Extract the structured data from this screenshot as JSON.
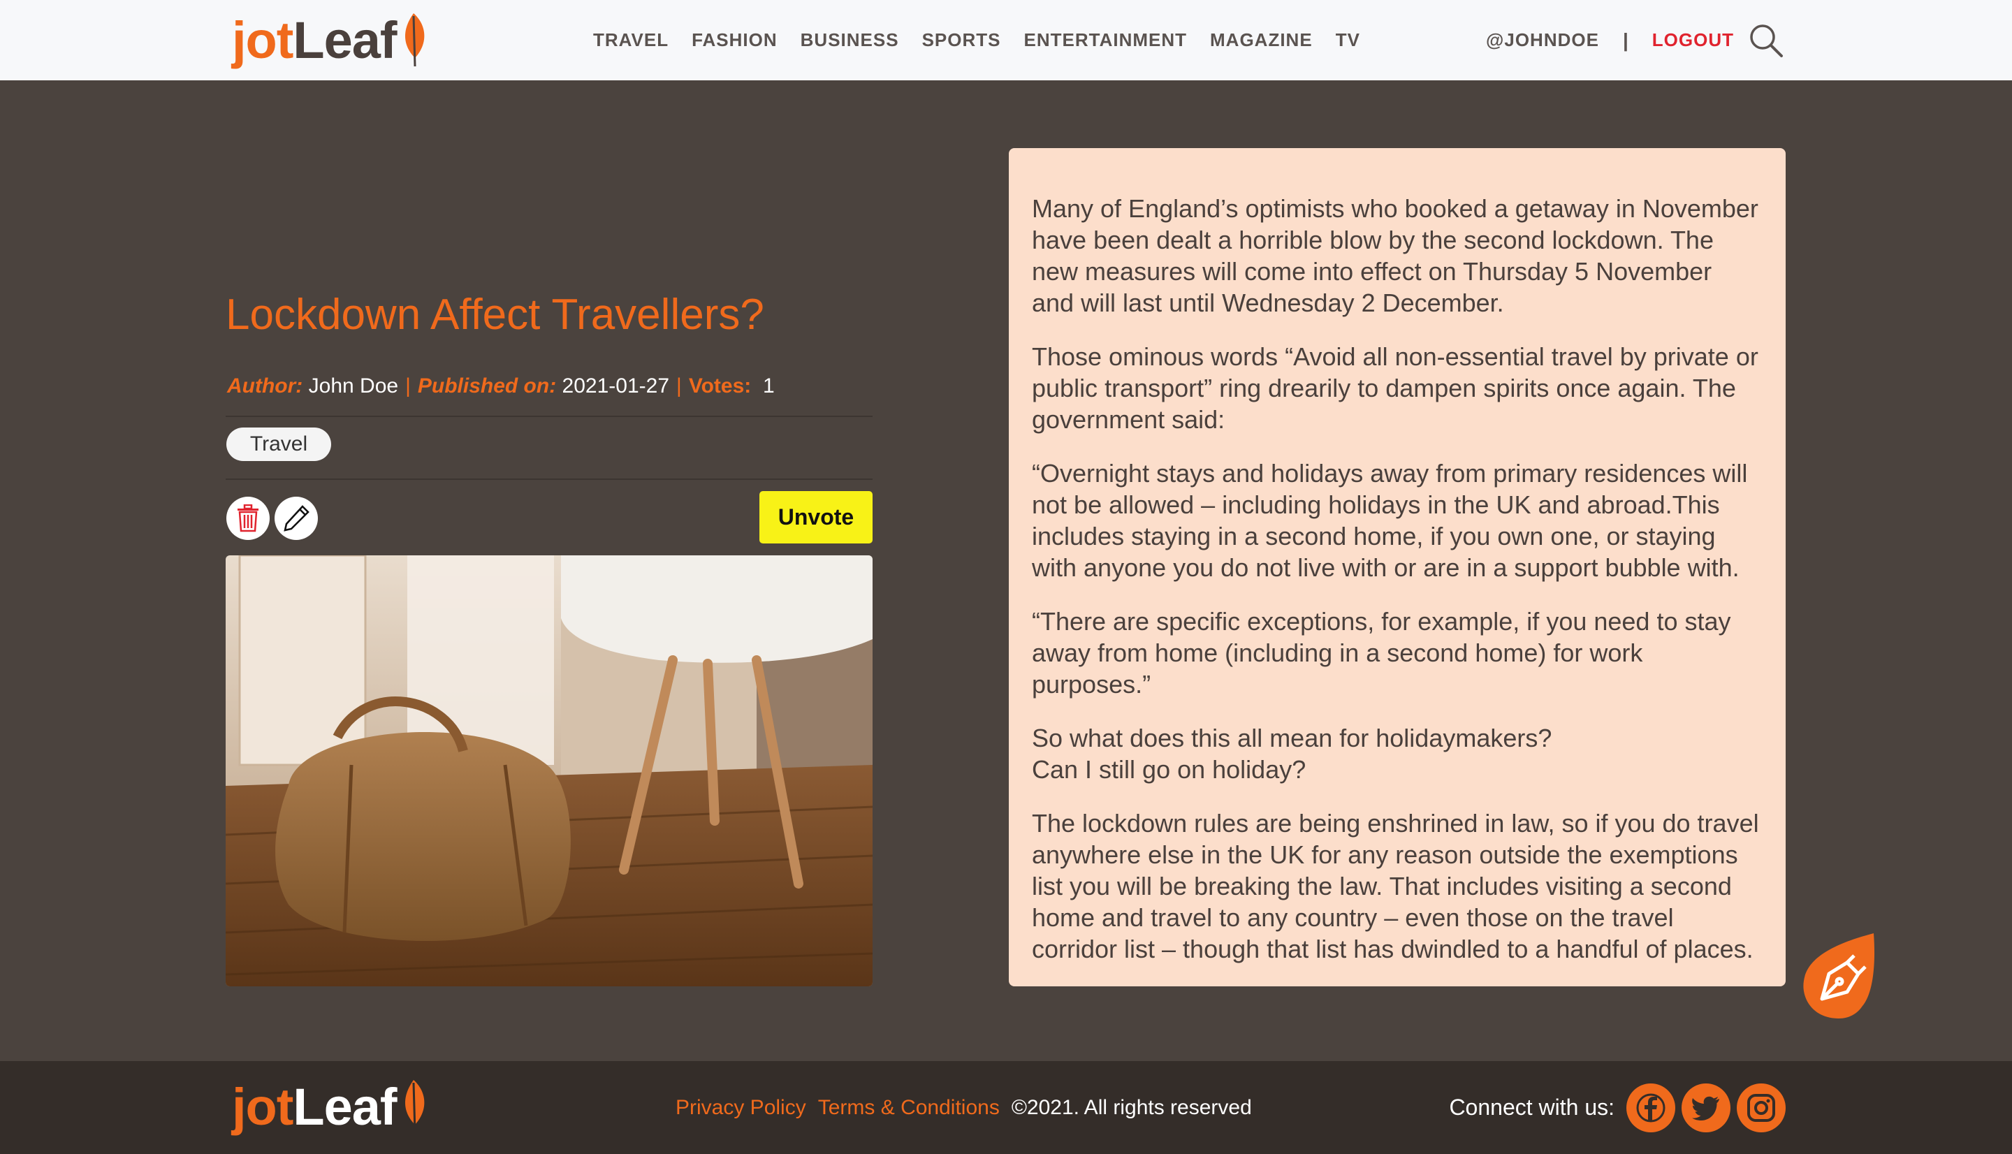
{
  "header": {
    "logo": {
      "part1": "jot",
      "part2": "Leaf"
    },
    "nav": [
      "TRAVEL",
      "FASHION",
      "BUSINESS",
      "SPORTS",
      "ENTERTAINMENT",
      "MAGAZINE",
      "TV"
    ],
    "username": "@JOHNDOE",
    "separator": "|",
    "logout": "LOGOUT",
    "search_icon": "search-icon"
  },
  "article": {
    "title": "Lockdown Affect Travellers?",
    "author_label": "Author:",
    "author": "John Doe",
    "published_label": "Published on:",
    "published": "2021-01-27",
    "votes_label": "Votes:",
    "votes": "1",
    "meta_separator": "|",
    "tag": "Travel",
    "delete_icon": "trash-icon",
    "edit_icon": "pencil-icon",
    "vote_button": "Unvote",
    "paragraphs": [
      "Many of England’s optimists who booked a getaway in November have been dealt a horrible blow by the second lockdown. The new measures will come into effect on Thursday 5 November and will last until Wednesday 2 December.",
      "Those ominous words “Avoid all non-essential travel by private or public transport” ring drearily to dampen spirits once again. The government said:",
      "“Overnight stays and holidays away from primary residences will not be allowed – including holidays in the UK and abroad.This includes staying in a second home, if you own one, or staying with anyone you do not live with or are in a support bubble with.",
      "“There are specific exceptions, for example, if you need to stay away from home (including in a second home) for work purposes.”",
      "So what does this all mean for holidaymakers?\nCan I still go on holiday?",
      "The lockdown rules are being enshrined in law, so if you do travel anywhere else in the UK for any reason outside the exemptions list you will be breaking the law. That includes visiting a second home and travel to any country – even those on the travel corridor list – though that list has dwindled to a handful of places."
    ]
  },
  "fab_icon": "pen-nib-icon",
  "footer": {
    "logo": {
      "part1": "jot",
      "part2": "Leaf"
    },
    "privacy": "Privacy Policy",
    "terms": "Terms & Conditions",
    "copyright": "©2021. All rights reserved",
    "connect": "Connect with us:",
    "social": [
      "facebook-icon",
      "twitter-icon",
      "instagram-icon"
    ]
  },
  "colors": {
    "accent": "#f06a1c",
    "background": "#4b433e",
    "card": "#fcdecb",
    "footer": "#342d29",
    "vote_button": "#f8f217",
    "logout": "#e0232e"
  }
}
